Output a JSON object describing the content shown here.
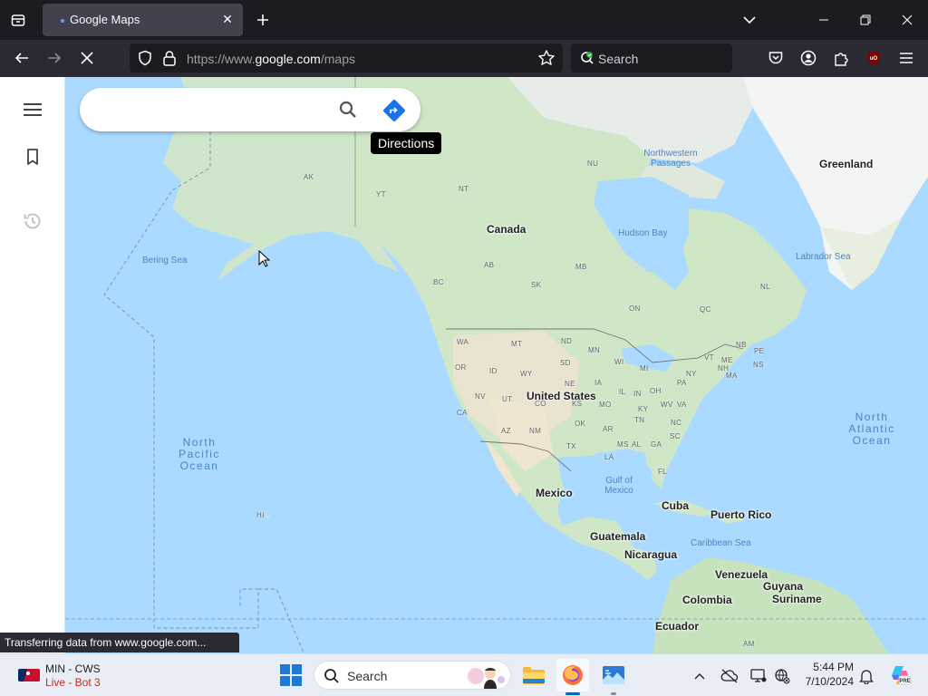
{
  "browser": {
    "tab": {
      "title": "Google Maps"
    },
    "url": {
      "prefix": "https://www.",
      "host": "google.com",
      "path": "/maps"
    },
    "search_placeholder": "Search",
    "status_text": "Transferring data from www.google.com..."
  },
  "maps": {
    "search_placeholder": "",
    "directions_tooltip": "Directions",
    "countries": [
      {
        "id": "canada",
        "label": "Canada"
      },
      {
        "id": "united-states",
        "label": "United States"
      },
      {
        "id": "mexico",
        "label": "Mexico"
      },
      {
        "id": "greenland",
        "label": "Greenland"
      },
      {
        "id": "cuba",
        "label": "Cuba"
      },
      {
        "id": "puerto-rico",
        "label": "Puerto Rico"
      },
      {
        "id": "guatemala",
        "label": "Guatemala"
      },
      {
        "id": "nicaragua",
        "label": "Nicaragua"
      },
      {
        "id": "venezuela",
        "label": "Venezuela"
      },
      {
        "id": "guyana",
        "label": "Guyana"
      },
      {
        "id": "colombia",
        "label": "Colombia"
      },
      {
        "id": "suriname",
        "label": "Suriname"
      },
      {
        "id": "ecuador",
        "label": "Ecuador"
      }
    ],
    "water": [
      {
        "id": "bering-sea",
        "label": "Bering Sea"
      },
      {
        "id": "hudson-bay",
        "label": "Hudson Bay"
      },
      {
        "id": "labrador-sea",
        "label": "Labrador Sea"
      },
      {
        "id": "northwestern-passages",
        "label": "Northwestern Passages"
      },
      {
        "id": "gulf-of-mexico",
        "label": "Gulf of Mexico"
      },
      {
        "id": "caribbean-sea",
        "label": "Caribbean Sea"
      },
      {
        "id": "north-pacific-ocean",
        "label": "North Pacific Ocean"
      },
      {
        "id": "north-atlantic-ocean",
        "label": "North Atlantic Ocean"
      }
    ],
    "regions": [
      "AK",
      "YT",
      "NT",
      "NU",
      "BC",
      "AB",
      "SK",
      "MB",
      "ON",
      "QC",
      "NL",
      "WA",
      "MT",
      "ND",
      "MN",
      "OR",
      "ID",
      "WY",
      "SD",
      "WI",
      "MI",
      "NV",
      "UT",
      "NE",
      "IA",
      "IL",
      "IN",
      "OH",
      "PA",
      "NY",
      "ME",
      "VT",
      "NH",
      "MA",
      "CA",
      "CO",
      "KS",
      "MO",
      "KY",
      "WV",
      "VA",
      "AZ",
      "NM",
      "OK",
      "AR",
      "TN",
      "NC",
      "TX",
      "MS",
      "AL",
      "GA",
      "SC",
      "LA",
      "FL",
      "NB",
      "PE",
      "NS",
      "HI",
      "AM"
    ]
  },
  "taskbar": {
    "score": {
      "teams": "MIN - CWS",
      "status": "Live - Bot 3"
    },
    "search_placeholder": "Search",
    "time": "5:44 PM",
    "date": "7/10/2024"
  }
}
